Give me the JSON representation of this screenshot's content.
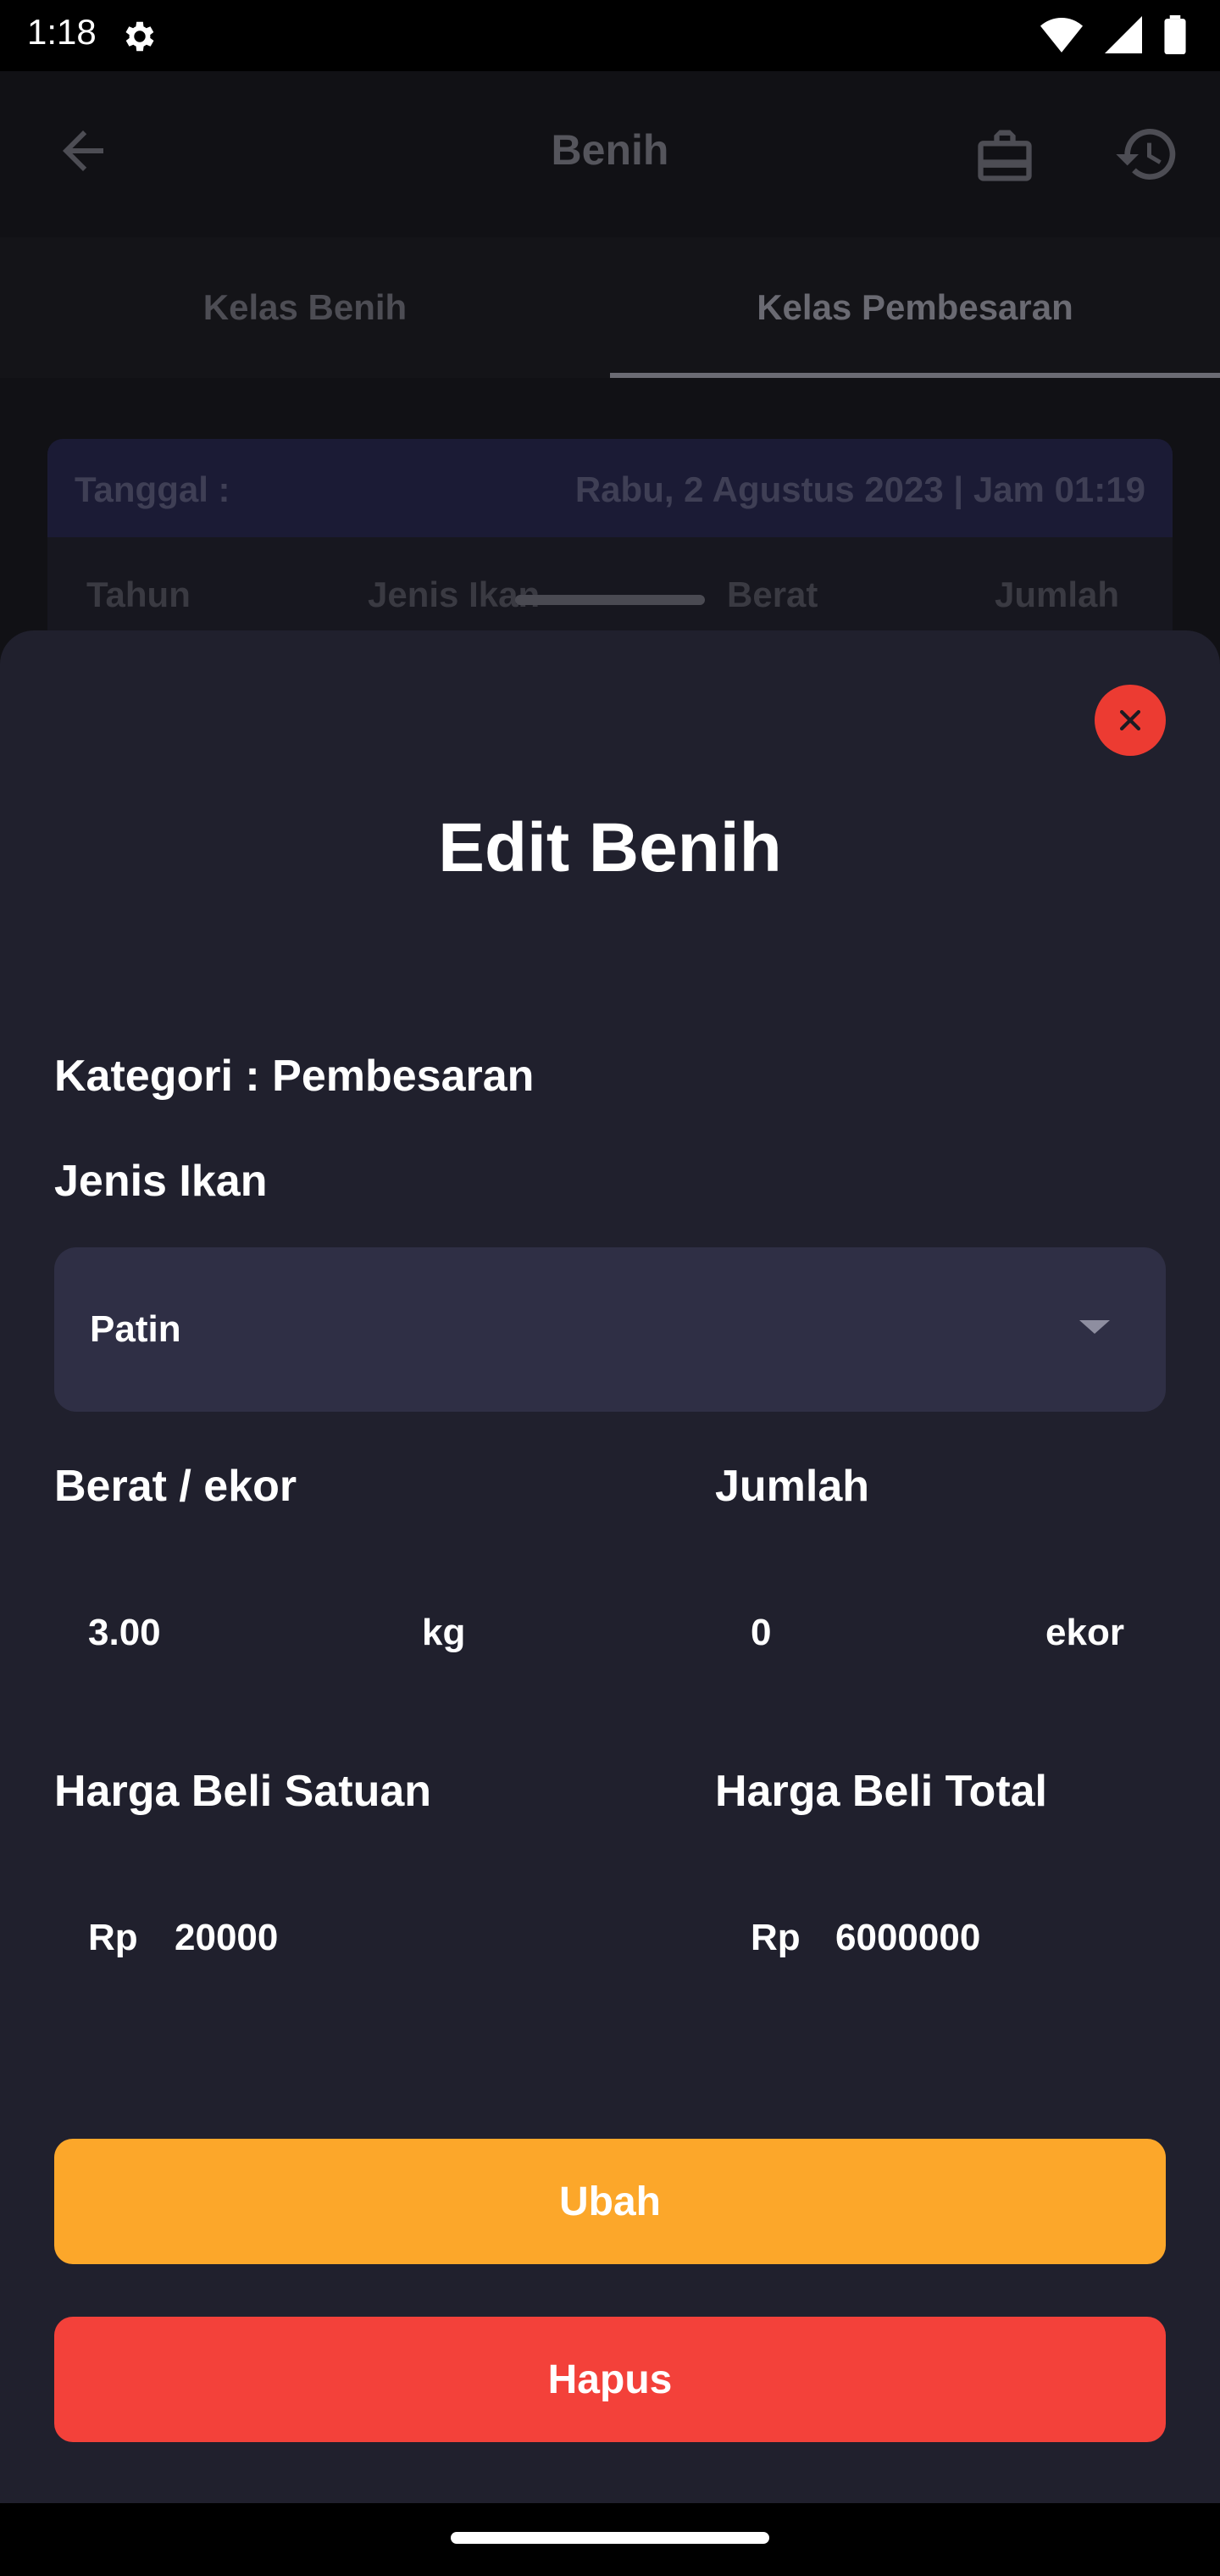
{
  "status_bar": {
    "time": "1:18"
  },
  "appbar": {
    "title": "Benih"
  },
  "tabs": [
    {
      "label": "Kelas Benih"
    },
    {
      "label": "Kelas Pembesaran"
    }
  ],
  "card": {
    "date_label": "Tanggal :",
    "date_value": "Rabu, 2 Agustus 2023 | Jam 01:19",
    "columns": [
      "Tahun",
      "Jenis Ikan",
      "Berat",
      "Jumlah"
    ]
  },
  "sheet": {
    "title": "Edit Benih",
    "kategori": "Kategori : Pembesaran",
    "jenis_ikan_label": "Jenis Ikan",
    "jenis_ikan_value": "Patin",
    "berat_label": "Berat / ekor",
    "berat_value": "3.00",
    "berat_unit": "kg",
    "jumlah_label": "Jumlah",
    "jumlah_value": "0",
    "jumlah_unit": "ekor",
    "harga_satuan_label": "Harga Beli Satuan",
    "harga_satuan_prefix": "Rp",
    "harga_satuan_value": "20000",
    "harga_total_label": "Harga Beli Total",
    "harga_total_prefix": "Rp",
    "harga_total_value": "6000000",
    "ubah_label": "Ubah",
    "hapus_label": "Hapus"
  },
  "colors": {
    "sheet_bg": "#20202d",
    "select_bg": "#2f2f45",
    "ubah": "#fca72a",
    "hapus": "#f3413a",
    "close": "#ec3b32"
  }
}
